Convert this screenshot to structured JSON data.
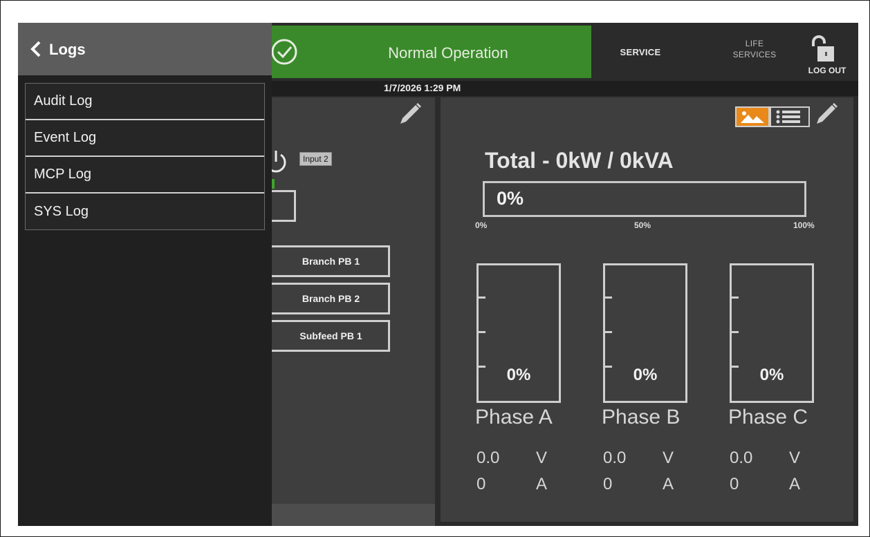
{
  "sidebar": {
    "title": "Logs",
    "items": [
      {
        "label": "Audit Log"
      },
      {
        "label": "Event Log"
      },
      {
        "label": "MCP Log"
      },
      {
        "label": "SYS Log"
      }
    ]
  },
  "header": {
    "status_text": "Normal Operation",
    "status_icon": "check-circle-icon",
    "status_color": "#3a8a2b",
    "nav_service": "SERVICE",
    "nav_life_line1": "LIFE",
    "nav_life_line2": "SERVICES",
    "logout_label": "LOG OUT",
    "logout_icon": "unlocked-padlock-icon",
    "datetime": "1/7/2026 1:29 PM"
  },
  "middle_panel": {
    "input_badge": "Input 2",
    "buttons": [
      {
        "label": "Branch PB 1"
      },
      {
        "label": "Branch PB 2"
      },
      {
        "label": "Subfeed PB 1"
      }
    ]
  },
  "right_panel": {
    "total_label": "Total - 0kW / 0kVA",
    "total_percent_text": "0%",
    "total_load_fraction": 0,
    "axis_labels": [
      "0%",
      "50%",
      "100%"
    ],
    "accent_color": "#e8891a",
    "phases": [
      {
        "name": "Phase A",
        "percent_text": "0%",
        "load_fraction": 0,
        "voltage": "0.0",
        "voltage_unit": "V",
        "current": "0",
        "current_unit": "A"
      },
      {
        "name": "Phase B",
        "percent_text": "0%",
        "load_fraction": 0,
        "voltage": "0.0",
        "voltage_unit": "V",
        "current": "0",
        "current_unit": "A"
      },
      {
        "name": "Phase C",
        "percent_text": "0%",
        "load_fraction": 0,
        "voltage": "0.0",
        "voltage_unit": "V",
        "current": "0",
        "current_unit": "A"
      }
    ]
  }
}
